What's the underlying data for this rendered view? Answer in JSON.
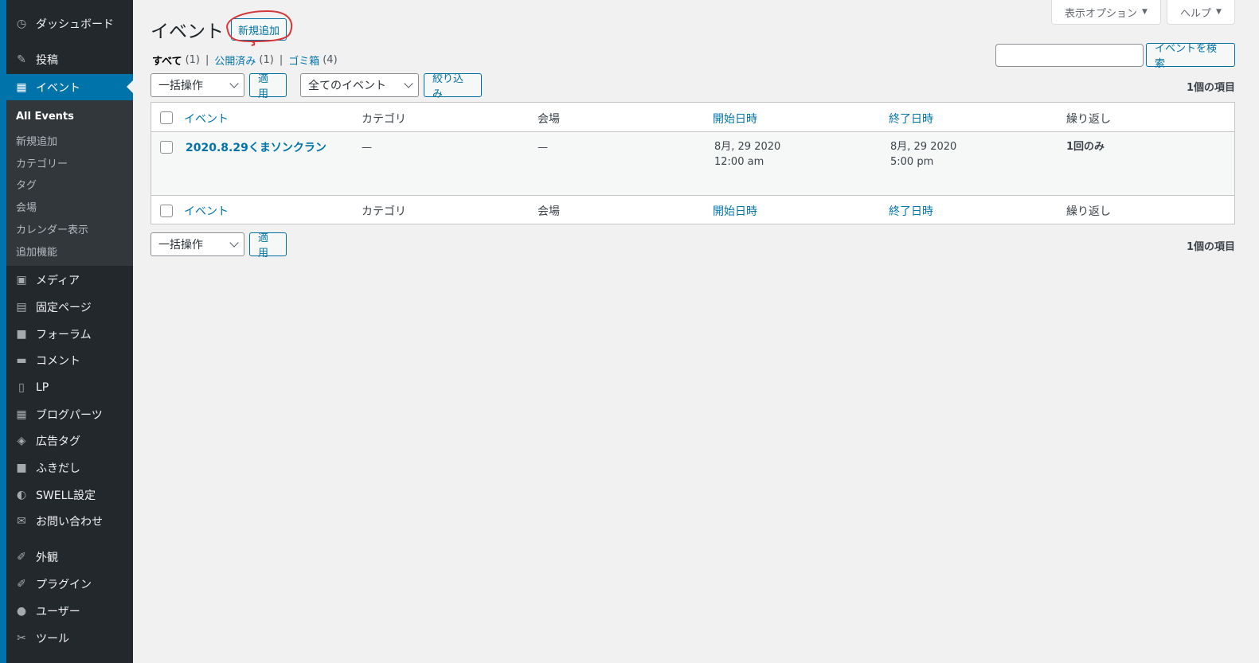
{
  "sidebar": {
    "menu_top": [
      {
        "label": "ダッシュボード",
        "icon": "dashboard-icon",
        "glyph": "◷"
      },
      {
        "label": "投稿",
        "icon": "pin-icon",
        "glyph": "✎"
      },
      {
        "label": "イベント",
        "icon": "calendar-icon",
        "glyph": "▦",
        "active": true
      }
    ],
    "submenu": [
      "All Events",
      "新規追加",
      "カテゴリー",
      "タグ",
      "会場",
      "カレンダー表示",
      "追加機能"
    ],
    "menu_bottom": [
      {
        "label": "メディア",
        "icon": "media-icon",
        "glyph": "▣"
      },
      {
        "label": "固定ページ",
        "icon": "page-icon",
        "glyph": "▤"
      },
      {
        "label": "フォーラム",
        "icon": "forum-icon",
        "glyph": "■"
      },
      {
        "label": "コメント",
        "icon": "comment-icon",
        "glyph": "▬"
      },
      {
        "label": "LP",
        "icon": "document-icon",
        "glyph": "▯"
      },
      {
        "label": "ブログパーツ",
        "icon": "table-icon",
        "glyph": "▦"
      },
      {
        "label": "広告タグ",
        "icon": "tag-stack-icon",
        "glyph": "◈"
      },
      {
        "label": "ふきだし",
        "icon": "bubble-icon",
        "glyph": "■"
      },
      {
        "label": "SWELL設定",
        "icon": "swell-icon",
        "glyph": "◐"
      },
      {
        "label": "お問い合わせ",
        "icon": "mail-icon",
        "glyph": "✉"
      },
      {
        "label": "外観",
        "icon": "brush-icon",
        "glyph": "✐"
      },
      {
        "label": "プラグイン",
        "icon": "plugin-icon",
        "glyph": "✐"
      },
      {
        "label": "ユーザー",
        "icon": "user-icon",
        "glyph": "●"
      },
      {
        "label": "ツール",
        "icon": "wrench-icon",
        "glyph": "✂"
      }
    ]
  },
  "screen_meta": {
    "options_label": "表示オプション",
    "help_label": "ヘルプ"
  },
  "header": {
    "title": "イベント",
    "add_new": "新規追加"
  },
  "filters": {
    "all": "すべて",
    "all_count": "(1)",
    "published": "公開済み",
    "published_count": "(1)",
    "trash": "ゴミ箱",
    "trash_count": "(4)"
  },
  "search": {
    "button": "イベントを検索",
    "value": ""
  },
  "bulk": {
    "action": "一括操作",
    "apply": "適用",
    "events_filter": "全てのイベント",
    "filter_button": "絞り込み"
  },
  "count_label": "1個の項目",
  "table": {
    "columns": [
      "イベント",
      "カテゴリ",
      "会場",
      "開始日時",
      "終了日時",
      "繰り返し"
    ],
    "rows": [
      {
        "title": "2020.8.29くまソンクラン",
        "category": "—",
        "venue": "—",
        "start_date": "8月, 29 2020",
        "start_time": "12:00 am",
        "end_date": "8月, 29 2020",
        "end_time": "5:00 pm",
        "repeat": "1回のみ"
      }
    ]
  },
  "colors": {
    "accent": "#0073aa",
    "sidebar_bg": "#23282d",
    "annotation": "#d63638"
  }
}
